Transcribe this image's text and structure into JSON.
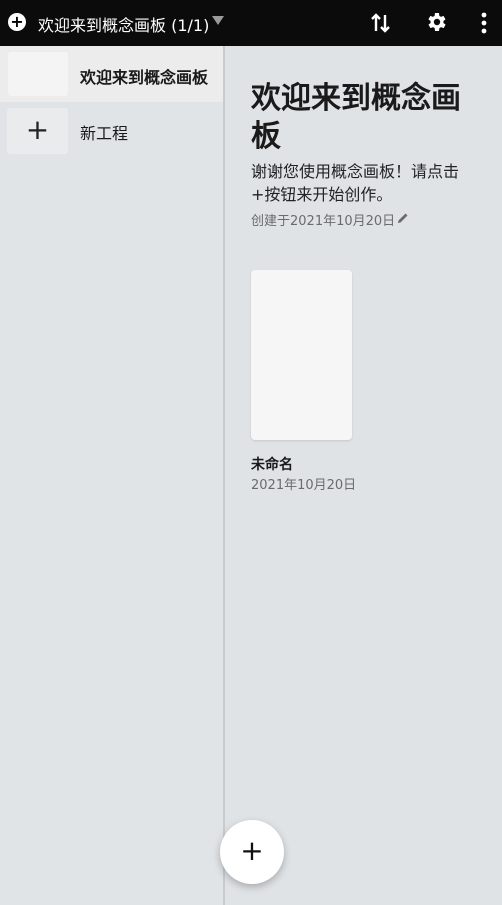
{
  "topbar": {
    "add_icon": "plus-circle",
    "title": "欢迎来到概念画板 (1/1)",
    "sort_icon": "sort-arrows",
    "settings_icon": "gear",
    "more_icon": "more-vertical"
  },
  "sidebar": {
    "items": [
      {
        "label": "欢迎来到概念画板",
        "active": true
      },
      {
        "label": "新工程",
        "icon": "+"
      }
    ]
  },
  "main": {
    "title": "欢迎来到概念画板",
    "description": "谢谢您使用概念画板！请点击+按钮来开始创作。",
    "created": "创建于2021年10月20日",
    "edit_icon": "pencil",
    "card": {
      "name": "未命名",
      "date": "2021年10月20日"
    }
  },
  "fab": {
    "label": "+"
  }
}
